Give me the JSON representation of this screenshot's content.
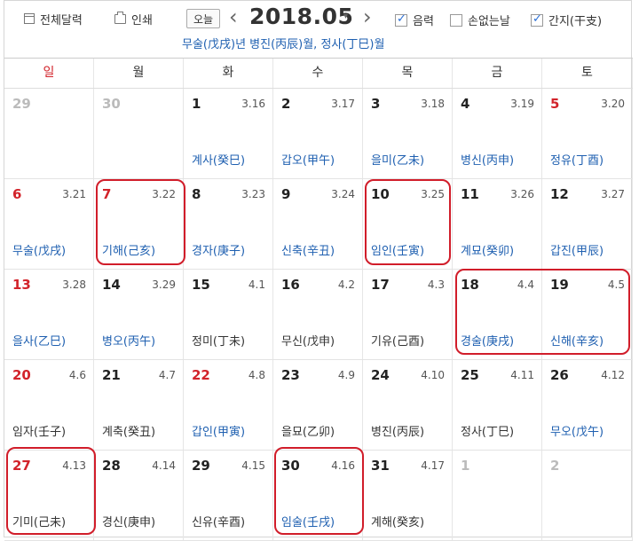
{
  "toolbar": {
    "full_calendar": "전체달력",
    "print": "인쇄",
    "today": "오늘",
    "prev_arrow": "‹",
    "next_arrow": "›",
    "month": "2018.05",
    "caret": "▾",
    "opt_lunar": {
      "label": "음력",
      "checked": true
    },
    "opt_sonless": {
      "label": "손없는날",
      "checked": false
    },
    "opt_ganji": {
      "label": "간지(干支)",
      "checked": true
    },
    "ganji_line": "무술(戊戌)년 병진(丙辰)월, 정사(丁巳)월"
  },
  "weekdays": [
    "일",
    "월",
    "화",
    "수",
    "목",
    "금",
    "토"
  ],
  "weeks": [
    [
      {
        "day": "29",
        "lunar": "",
        "ganji": "",
        "color": "grey"
      },
      {
        "day": "30",
        "lunar": "",
        "ganji": "",
        "color": "grey"
      },
      {
        "day": "1",
        "lunar": "3.16",
        "ganji": "계사(癸巳)",
        "color": "normal"
      },
      {
        "day": "2",
        "lunar": "3.17",
        "ganji": "갑오(甲午)",
        "color": "normal"
      },
      {
        "day": "3",
        "lunar": "3.18",
        "ganji": "을미(乙未)",
        "color": "normal"
      },
      {
        "day": "4",
        "lunar": "3.19",
        "ganji": "병신(丙申)",
        "color": "normal"
      },
      {
        "day": "5",
        "lunar": "3.20",
        "ganji": "정유(丁酉)",
        "color": "red"
      }
    ],
    [
      {
        "day": "6",
        "lunar": "3.21",
        "ganji": "무술(戊戌)",
        "color": "red"
      },
      {
        "day": "7",
        "lunar": "3.22",
        "ganji": "기해(己亥)",
        "color": "red"
      },
      {
        "day": "8",
        "lunar": "3.23",
        "ganji": "경자(庚子)",
        "color": "normal"
      },
      {
        "day": "9",
        "lunar": "3.24",
        "ganji": "신축(辛丑)",
        "color": "normal"
      },
      {
        "day": "10",
        "lunar": "3.25",
        "ganji": "임인(壬寅)",
        "color": "normal"
      },
      {
        "day": "11",
        "lunar": "3.26",
        "ganji": "계묘(癸卯)",
        "color": "normal"
      },
      {
        "day": "12",
        "lunar": "3.27",
        "ganji": "갑진(甲辰)",
        "color": "normal"
      }
    ],
    [
      {
        "day": "13",
        "lunar": "3.28",
        "ganji": "을사(乙巳)",
        "color": "red"
      },
      {
        "day": "14",
        "lunar": "3.29",
        "ganji": "병오(丙午)",
        "color": "normal"
      },
      {
        "day": "15",
        "lunar": "4.1",
        "ganji": "정미(丁未)",
        "color": "normal"
      },
      {
        "day": "16",
        "lunar": "4.2",
        "ganji": "무신(戊申)",
        "color": "normal"
      },
      {
        "day": "17",
        "lunar": "4.3",
        "ganji": "기유(己酉)",
        "color": "normal"
      },
      {
        "day": "18",
        "lunar": "4.4",
        "ganji": "경술(庚戌)",
        "color": "normal"
      },
      {
        "day": "19",
        "lunar": "4.5",
        "ganji": "신해(辛亥)",
        "color": "normal"
      }
    ],
    [
      {
        "day": "20",
        "lunar": "4.6",
        "ganji": "임자(壬子)",
        "color": "red"
      },
      {
        "day": "21",
        "lunar": "4.7",
        "ganji": "계축(癸丑)",
        "color": "normal"
      },
      {
        "day": "22",
        "lunar": "4.8",
        "ganji": "갑인(甲寅)",
        "color": "red"
      },
      {
        "day": "23",
        "lunar": "4.9",
        "ganji": "을묘(乙卯)",
        "color": "normal"
      },
      {
        "day": "24",
        "lunar": "4.10",
        "ganji": "병진(丙辰)",
        "color": "normal"
      },
      {
        "day": "25",
        "lunar": "4.11",
        "ganji": "정사(丁巳)",
        "color": "normal"
      },
      {
        "day": "26",
        "lunar": "4.12",
        "ganji": "무오(戊午)",
        "color": "normal"
      }
    ],
    [
      {
        "day": "27",
        "lunar": "4.13",
        "ganji": "기미(己未)",
        "color": "red"
      },
      {
        "day": "28",
        "lunar": "4.14",
        "ganji": "경신(庚申)",
        "color": "normal"
      },
      {
        "day": "29",
        "lunar": "4.15",
        "ganji": "신유(辛酉)",
        "color": "normal"
      },
      {
        "day": "30",
        "lunar": "4.16",
        "ganji": "임술(壬戌)",
        "color": "normal"
      },
      {
        "day": "31",
        "lunar": "4.17",
        "ganji": "계해(癸亥)",
        "color": "normal"
      },
      {
        "day": "1",
        "lunar": "",
        "ganji": "",
        "color": "grey"
      },
      {
        "day": "2",
        "lunar": "",
        "ganji": "",
        "color": "grey"
      }
    ]
  ],
  "colors": {
    "holiday_red": "#d2232a",
    "ganji_blue": "#1e5fb0",
    "highlight_red": "#d11d2a",
    "checkbox_blue": "#2b6fd6"
  }
}
